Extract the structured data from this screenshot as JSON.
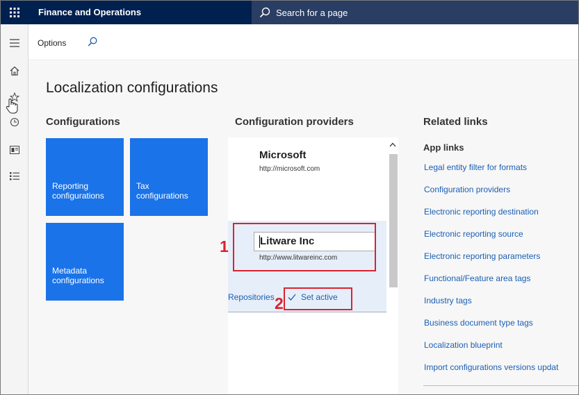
{
  "app": {
    "title": "Finance and Operations"
  },
  "search": {
    "placeholder": "Search for a page"
  },
  "actionpane": {
    "options_label": "Options"
  },
  "workspace": {
    "title": "Localization configurations",
    "configurations": {
      "heading": "Configurations",
      "tiles": [
        {
          "line1": "Reporting",
          "line2": "configurations"
        },
        {
          "line1": "Tax",
          "line2": "configurations"
        },
        {
          "line1": "Metadata",
          "line2": "configurations"
        }
      ]
    },
    "providers": {
      "heading": "Configuration providers",
      "items": [
        {
          "name": "Microsoft",
          "url": "http://microsoft.com"
        },
        {
          "name": "Litware Inc",
          "url": "http://www.litwareinc.com"
        }
      ],
      "repositories_label": "Repositories",
      "set_active_label": "Set active"
    },
    "related_links": {
      "heading": "Related links",
      "subheading": "App links",
      "links": [
        "Legal entity filter for formats",
        "Configuration providers",
        "Electronic reporting destination",
        "Electronic reporting source",
        "Electronic reporting parameters",
        "Functional/Feature area tags",
        "Industry tags",
        "Business document type tags",
        "Localization blueprint",
        "Import configurations versions updat"
      ]
    },
    "annotations": {
      "one": "1",
      "two": "2"
    }
  },
  "icons": {
    "waffle": "waffle-icon",
    "search": "search-icon",
    "hamburger": "hamburger-icon",
    "home": "home-icon",
    "star": "star-icon",
    "recent": "clock-icon",
    "workspaces": "workspace-icon",
    "modules": "list-icon",
    "cursor": "hand-cursor-icon"
  },
  "colors": {
    "topbar": "#002050",
    "tile": "#1a73e8",
    "link": "#1a5fb4",
    "annotation": "#d9232e"
  }
}
